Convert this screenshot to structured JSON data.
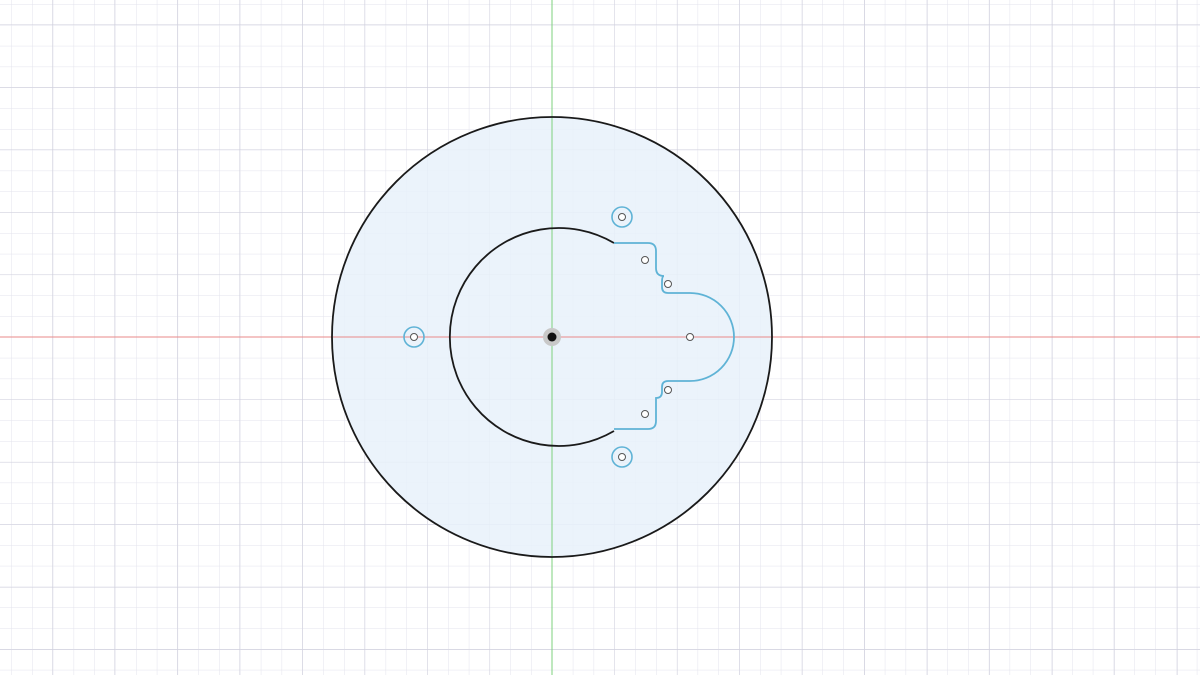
{
  "canvas": {
    "background": "#ffffff",
    "grid": {
      "visible": true,
      "minor_color": "#e3e3ec",
      "major_color": "#cfcfdc"
    },
    "axes": {
      "x_axis_color": "#e88a8a",
      "y_axis_color": "#7ed07e"
    }
  },
  "sketch": {
    "profile_fill": "#e7f1fa",
    "outline_color": "#1a1a1a",
    "construction_color": "#5fb3d6",
    "origin_marker": "origin-point",
    "shapes": [
      "outer-circle",
      "inner-profile",
      "tab-profile",
      "mount-hole-left",
      "mount-hole-top",
      "mount-hole-bottom"
    ]
  }
}
